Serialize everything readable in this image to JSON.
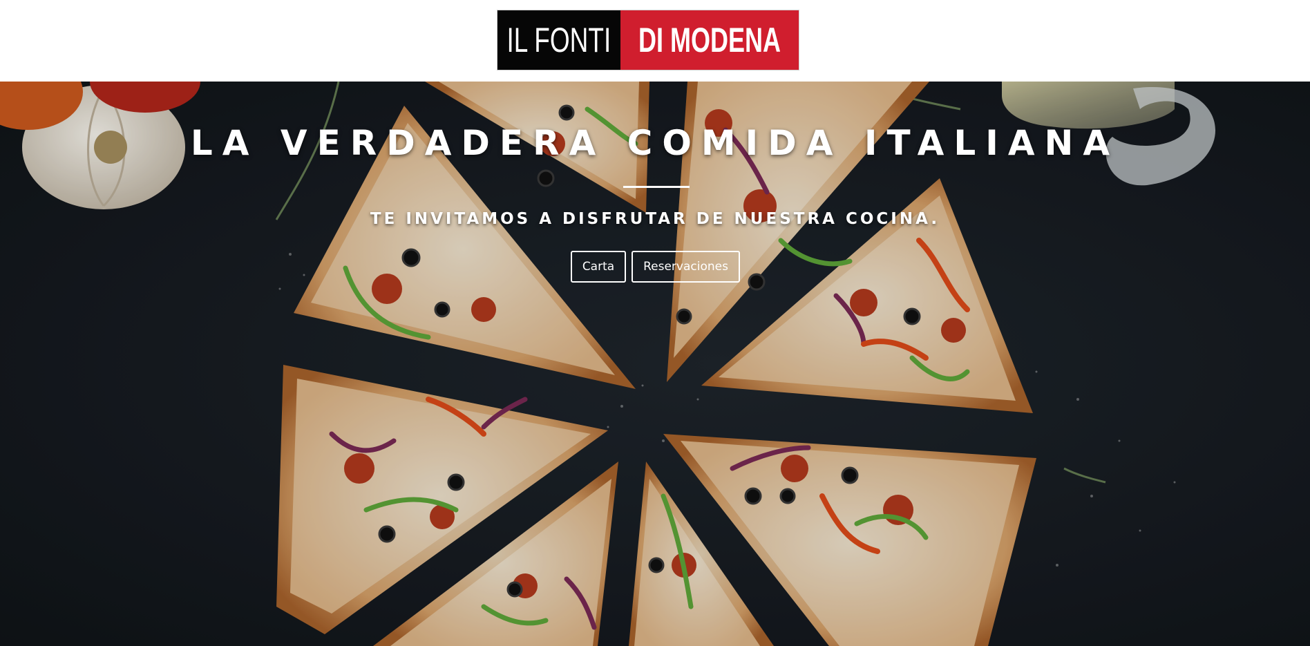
{
  "header": {
    "logo": {
      "part1": "IL FONTI",
      "part2": "DI MODENA",
      "colors": {
        "left_bg": "#060606",
        "right_bg": "#d01e2e",
        "text": "#ffffff"
      }
    }
  },
  "hero": {
    "background_image": "pizza-photo",
    "title": "LA VERDADERA COMIDA ITALIANA",
    "subtitle": "TE INVITAMOS A DISFRUTAR DE NUESTRA COCINA.",
    "buttons": [
      {
        "label": "Carta"
      },
      {
        "label": "Reservaciones"
      }
    ]
  }
}
